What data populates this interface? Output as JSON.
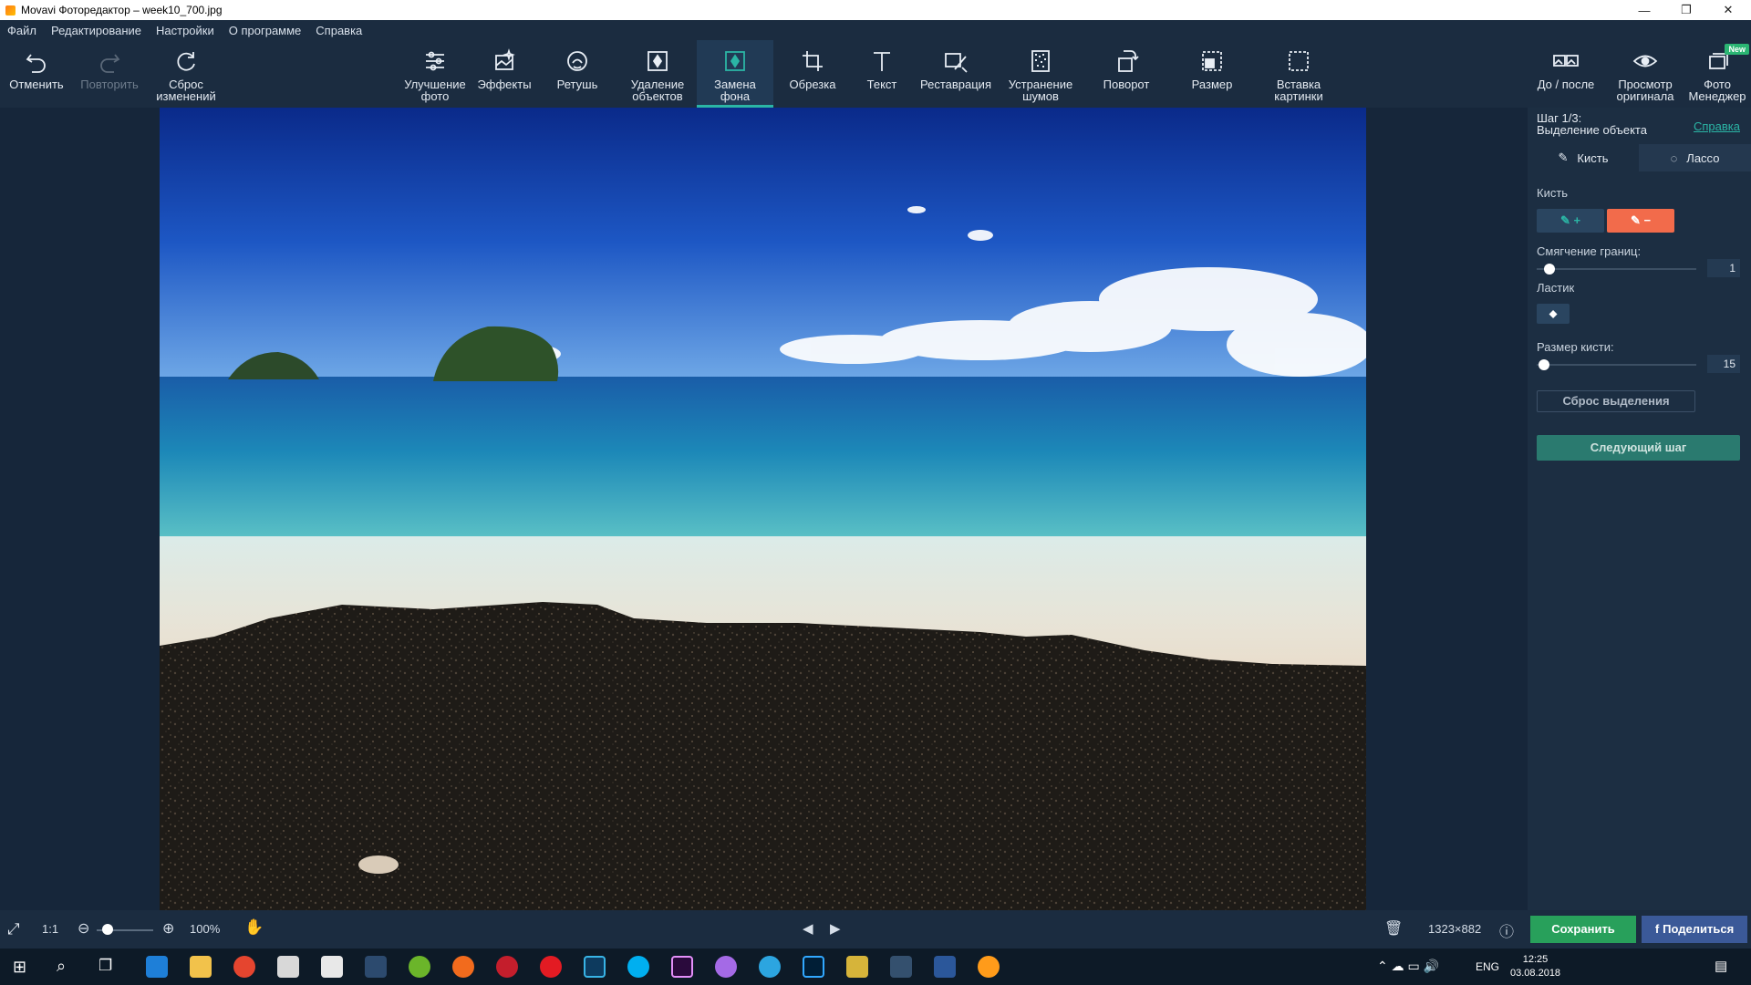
{
  "window": {
    "title": "Movavi Фоторедактор – week10_700.jpg",
    "minimize": "—",
    "maximize": "❐",
    "close": "✕"
  },
  "menu": [
    "Файл",
    "Редактирование",
    "Настройки",
    "О программе",
    "Справка"
  ],
  "toolbar": {
    "undo": "Отменить",
    "redo": "Повторить",
    "reset": [
      "Сброс",
      "изменений"
    ],
    "enhance": [
      "Улучшение",
      "фото"
    ],
    "effects": "Эффекты",
    "retouch": "Ретушь",
    "remove_objects": [
      "Удаление",
      "объектов"
    ],
    "replace_bg": [
      "Замена",
      "фона"
    ],
    "crop": "Обрезка",
    "text": "Текст",
    "restore": "Реставрация",
    "denoise": [
      "Устранение",
      "шумов"
    ],
    "rotate": "Поворот",
    "resize": "Размер",
    "insert": [
      "Вставка",
      "картинки"
    ],
    "before_after": "До / после",
    "view_original": [
      "Просмотр",
      "оригинала"
    ],
    "photo_manager": [
      "Фото",
      "Менеджер"
    ],
    "new_badge": "New"
  },
  "panel": {
    "step": "Шаг 1/3:",
    "step_desc": "Выделение объекта",
    "help": "Справка",
    "tab_brush": "Кисть",
    "tab_lasso": "Лассо",
    "brush_label": "Кисть",
    "smoothing_label": "Смягчение границ:",
    "smoothing_value": "1",
    "eraser_label": "Ластик",
    "brush_size_label": "Размер кисти:",
    "brush_size_value": "15",
    "reset_selection": "Сброс выделения",
    "next_step": "Следующий шаг"
  },
  "bottombar": {
    "ratio": "1:1",
    "zoom": "100%",
    "dimensions": "1323×882",
    "save": "Сохранить",
    "share": "Поделиться"
  },
  "taskbar": {
    "lang": "ENG",
    "time": "12:25",
    "date": "03.08.2018"
  }
}
